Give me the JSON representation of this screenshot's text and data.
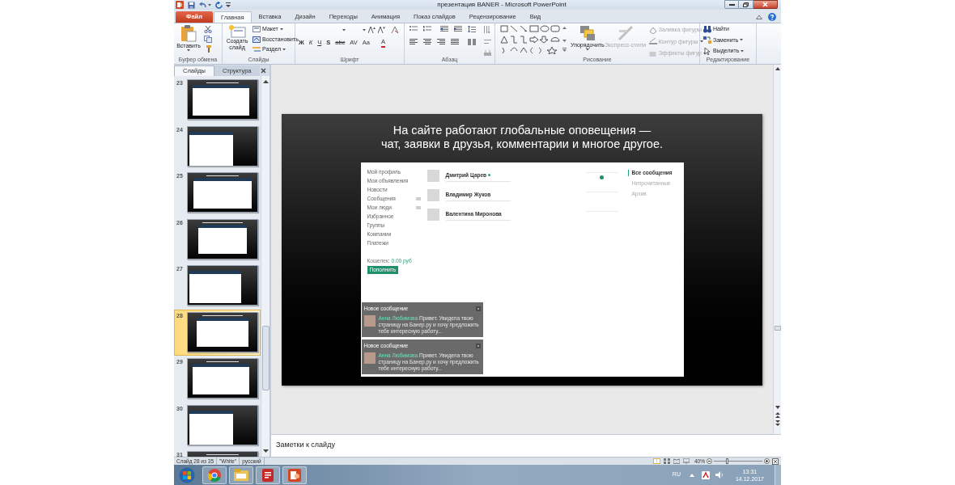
{
  "window": {
    "title": "презентация BANER - Microsoft PowerPoint"
  },
  "ribbon_tabs": [
    {
      "label": "Файл",
      "kind": "file",
      "selected": false
    },
    {
      "label": "Главная",
      "kind": "tab",
      "selected": true
    },
    {
      "label": "Вставка",
      "kind": "tab",
      "selected": false
    },
    {
      "label": "Дизайн",
      "kind": "tab",
      "selected": false
    },
    {
      "label": "Переходы",
      "kind": "tab",
      "selected": false
    },
    {
      "label": "Анимация",
      "kind": "tab",
      "selected": false
    },
    {
      "label": "Показ слайдов",
      "kind": "tab",
      "selected": false
    },
    {
      "label": "Рецензирование",
      "kind": "tab",
      "selected": false
    },
    {
      "label": "Вид",
      "kind": "tab",
      "selected": false
    }
  ],
  "ribbon": {
    "clipboard": {
      "label": "Буфер обмена",
      "paste": "Вставить"
    },
    "slides": {
      "label": "Слайды",
      "new_slide": "Создать слайд",
      "items": [
        "Макет",
        "Восстановить",
        "Раздел"
      ]
    },
    "font": {
      "label": "Шрифт",
      "buttons": [
        {
          "text": "Ж",
          "kind": "bold"
        },
        {
          "text": "К",
          "kind": "italic"
        },
        {
          "text": "Ч",
          "kind": "underline"
        },
        {
          "text": "S",
          "kind": "shadow"
        },
        {
          "text": "abc",
          "kind": "strike"
        },
        {
          "text": "AV",
          "kind": "spacing"
        },
        {
          "text": "Aa",
          "kind": "case"
        },
        {
          "text": "A",
          "kind": "color"
        }
      ]
    },
    "paragraph": {
      "label": "Абзац"
    },
    "drawing": {
      "label": "Рисование",
      "arrange": "Упорядочить",
      "quick_styles": {
        "label": "Экспресс-стили",
        "disabled": true
      },
      "shape_format": [
        {
          "label": "Заливка фигуры",
          "disabled": true
        },
        {
          "label": "Контур фигуры",
          "disabled": true
        },
        {
          "label": "Эффекты фигур",
          "disabled": true
        }
      ]
    },
    "editing": {
      "label": "Редактирование",
      "items": [
        {
          "label": "Найти",
          "kind": "find"
        },
        {
          "label": "Заменить",
          "kind": "replace"
        },
        {
          "label": "Выделить",
          "kind": "select"
        }
      ]
    }
  },
  "slides_panel": {
    "tabs": [
      {
        "label": "Слайды",
        "selected": true
      },
      {
        "label": "Структура",
        "selected": false
      }
    ],
    "thumbnails": [
      {
        "number": "23",
        "selected": false
      },
      {
        "number": "24",
        "selected": false
      },
      {
        "number": "25",
        "selected": false
      },
      {
        "number": "26",
        "selected": false
      },
      {
        "number": "27",
        "selected": false
      },
      {
        "number": "28",
        "selected": true
      },
      {
        "number": "29",
        "selected": false
      },
      {
        "number": "30",
        "selected": false
      },
      {
        "number": "31",
        "selected": false
      }
    ]
  },
  "slide": {
    "title_lines": [
      "На сайте работают глобальные оповещения —",
      "чат, заявки в друзья, комментарии и многое другое."
    ],
    "site": {
      "menu": [
        {
          "label": "Мой профиль",
          "counter": false
        },
        {
          "label": "Мои объявления",
          "counter": false
        },
        {
          "label": "Новости",
          "counter": false
        },
        {
          "label": "Сообщения",
          "counter": true
        },
        {
          "label": "Мои люди",
          "counter": true
        },
        {
          "label": "Избранное",
          "counter": false
        },
        {
          "label": "Группы",
          "counter": false
        },
        {
          "label": "Компании",
          "counter": false
        },
        {
          "label": "Платежи",
          "counter": false
        }
      ],
      "wallet_label": "Кошелек:",
      "wallet_value": "0.00 руб",
      "top_up": "Пополнить",
      "messages": [
        {
          "name": "Дмитрий Царев",
          "online": true,
          "unread": true
        },
        {
          "name": "Владимир Жуков",
          "online": false,
          "unread": false
        },
        {
          "name": "Валентина Миронова",
          "online": false,
          "unread": false
        }
      ],
      "filters": [
        {
          "label": "Все сообщения",
          "selected": true
        },
        {
          "label": "Непрочитанные",
          "selected": false
        },
        {
          "label": "Архив",
          "selected": false
        }
      ],
      "notifications": [
        {
          "title": "Новое сообщение",
          "sender": "Анна Любимова",
          "text": "Привет. Увидела твою страницу на Банер.ру и хочу предложить тебе интересную работу..."
        },
        {
          "title": "Новое сообщение",
          "sender": "Анна Любимова",
          "text": "Привет. Увидела твою страницу на Банер.ру и хочу предложить тебе интересную работу..."
        }
      ]
    }
  },
  "notes": {
    "placeholder": "Заметки к слайду"
  },
  "status_bar": {
    "items": [
      "Слайд 28 из 35",
      "\"White\"",
      "русский"
    ],
    "zoom": "40%",
    "zoom_slider": {
      "level": 0.25
    }
  },
  "taskbar": {
    "apps": [
      {
        "kind": "start"
      },
      {
        "kind": "chrome"
      },
      {
        "kind": "explorer"
      },
      {
        "kind": "pdf"
      },
      {
        "kind": "powerpoint"
      }
    ],
    "language": "RU",
    "time": "13:31",
    "date": "14.12.2017"
  }
}
